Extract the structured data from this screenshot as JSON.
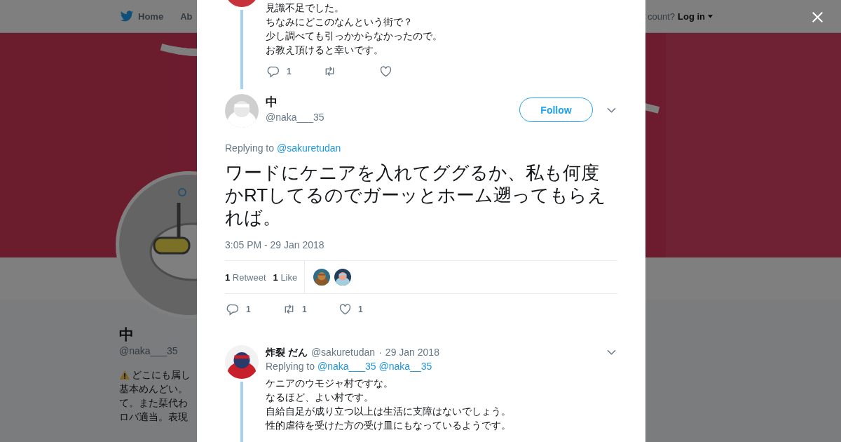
{
  "background_page": {
    "nav": [
      {
        "kind": "home",
        "label": "Home"
      },
      {
        "kind": "text",
        "label": "Ab"
      }
    ],
    "account_prompt": "count?",
    "login_label": "Log in",
    "profile": {
      "name": "中",
      "handle": "@naka___35",
      "bio_lines": [
        {
          "warning": true,
          "text": "どこにも属し"
        },
        {
          "warning": false,
          "text": "基本めんどい。"
        },
        {
          "warning": false,
          "text": "て。また栞代わ"
        },
        {
          "warning": false,
          "text": "ロバ適当。表現"
        }
      ]
    }
  },
  "modal": {
    "context_tweet": {
      "lines": [
        "見識不足でした。",
        "ちなみにどこのなんという街で？",
        "少し調べても引っかからなかったので。",
        "お教え頂けると幸いです。"
      ],
      "actions": [
        {
          "kind": "reply",
          "count": "1"
        },
        {
          "kind": "retweet"
        },
        {
          "kind": "like"
        }
      ]
    },
    "focused_tweet": {
      "name": "中",
      "handle": "@naka___35",
      "follow_label": "Follow",
      "replying_prefix": "Replying to",
      "replying_to": [
        "@sakuretudan"
      ],
      "text": "ワードにケニアを入れてググるか、私も何度かRTしてるのでガーッとホーム遡ってもらえれば。",
      "timestamp": "3:05 PM - 29 Jan 2018",
      "stats": [
        {
          "count": "1",
          "label": "Retweet"
        },
        {
          "count": "1",
          "label": "Like"
        }
      ],
      "likers": [
        {
          "kind": "picture"
        },
        {
          "kind": "picture"
        }
      ],
      "actions": [
        {
          "kind": "reply",
          "count": "1"
        },
        {
          "kind": "retweet",
          "count": "1"
        },
        {
          "kind": "like",
          "count": "1"
        }
      ]
    },
    "reply_tweet": {
      "name": "炸裂 だん",
      "handle": "@sakuretudan",
      "separator": "·",
      "date": "29 Jan 2018",
      "replying_prefix": "Replying to",
      "replying_to": [
        "@naka___35",
        "@naka__35"
      ],
      "lines": [
        "ケニアのウモジャ村ですな。",
        "なるほど、よい村です。",
        "自給自足が成り立つ以上は生活に支障はないでしょう。",
        "性的虐待を受けた方の受け皿にもなっているようです。"
      ]
    }
  }
}
